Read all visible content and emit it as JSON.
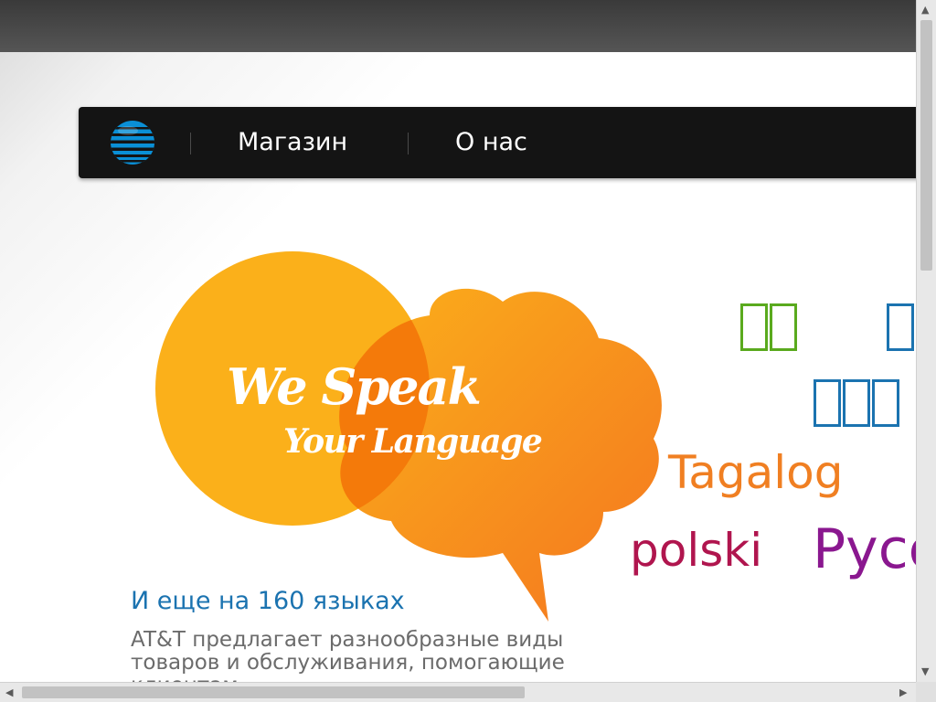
{
  "nav": {
    "shop_label": "Магазин",
    "about_label": "О нас"
  },
  "hero": {
    "line1": "We Speak",
    "line2": "Your Language"
  },
  "languages": {
    "tagalog": "Tagalog",
    "polski": "polski",
    "russian_partial": "Русс"
  },
  "promo": {
    "title": "И еще на 160 языках",
    "body": "AT&T предлагает разнообразные виды товаров и обслуживания, помогающие клиентам"
  },
  "colors": {
    "brand_blue": "#0a8fd6",
    "hero_yellow": "#fbb01a",
    "hero_orange": "#f7801e",
    "green": "#5aaa1e",
    "blue": "#1b73b0",
    "tagalog_orange": "#f07f22",
    "polski_crimson": "#b0154e",
    "purple": "#8a178f"
  },
  "icons": {
    "logo": "att-globe-logo",
    "scroll_up": "arrow-up-icon",
    "scroll_down": "arrow-down-icon",
    "scroll_left": "arrow-left-icon",
    "scroll_right": "arrow-right-icon"
  }
}
